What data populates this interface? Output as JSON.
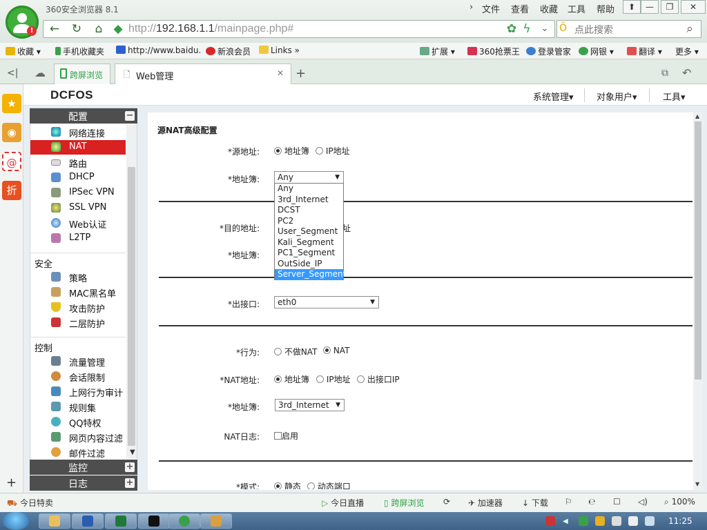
{
  "browser": {
    "title": "360安全浏览器 8.1",
    "menu": [
      "文件",
      "查看",
      "收藏",
      "工具",
      "帮助"
    ],
    "url_prefix": "http://",
    "url_host": "192.168.1.1",
    "url_path": "/mainpage.php#",
    "search_placeholder": "点此搜索",
    "bookmarks": [
      "收藏",
      "手机收藏夹",
      "http://www.baidu.",
      "新浪会员",
      "Links"
    ],
    "bookmark_right": [
      "扩展",
      "360抢票王",
      "登录管家",
      "网银",
      "翻译",
      "更多"
    ],
    "tabs": [
      "跨屏浏览",
      "Web管理"
    ],
    "status_left": "今日特卖",
    "status_items": [
      "今日直播",
      "跨屏浏览",
      "加速器",
      "下载"
    ],
    "zoom": "100%",
    "clock": "11:25"
  },
  "app": {
    "brand": "DCFOS",
    "menu": [
      "系统管理▾",
      "对象用户▾",
      "工具▾"
    ]
  },
  "nav": {
    "config_header": "配置",
    "config_items": [
      "网络连接",
      "NAT",
      "路由",
      "DHCP",
      "IPSec VPN",
      "SSL VPN",
      "Web认证",
      "L2TP"
    ],
    "security_header": "安全",
    "security_items": [
      "策略",
      "MAC黑名单",
      "攻击防护",
      "二层防护"
    ],
    "control_header": "控制",
    "control_items": [
      "流量管理",
      "会话限制",
      "上网行为审计",
      "规则集",
      "QQ特权",
      "网页内容过滤",
      "邮件过滤"
    ],
    "monitor_header": "监控",
    "log_header": "日志",
    "active_item": "NAT"
  },
  "form": {
    "title": "源NAT高级配置",
    "src_addr_label": "*源地址:",
    "src_addr_opts": [
      "地址簿",
      "IP地址"
    ],
    "addrbook_label": "*地址簿:",
    "addrbook_value": "Any",
    "addrbook_options": [
      "Any",
      "3rd_Internet",
      "DCST",
      "PC2",
      "User_Segment",
      "Kali_Segment",
      "PC1_Segment",
      "OutSide_IP",
      "Server_Segment"
    ],
    "addrbook_highlighted": "Server_Segment",
    "dst_addr_label": "*目的地址:",
    "dst_addr_partial": "址",
    "dst_addrbook_label": "*地址簿:",
    "egress_label": "*出接口:",
    "egress_value": "eth0",
    "action_label": "*行为:",
    "action_opts": [
      "不做NAT",
      "NAT"
    ],
    "nat_addr_label": "*NAT地址:",
    "nat_addr_opts": [
      "地址簿",
      "IP地址",
      "出接口IP"
    ],
    "nat_addrbook_label": "*地址簿:",
    "nat_addrbook_value": "3rd_Internet",
    "nat_log_label": "NAT日志:",
    "nat_log_opt": "启用",
    "mode_label": "*模式:",
    "mode_opts": [
      "静态",
      "动态端口"
    ]
  }
}
